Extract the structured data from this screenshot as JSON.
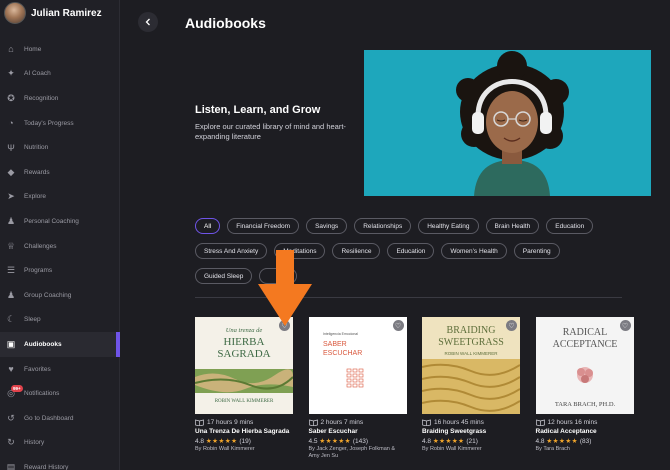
{
  "user": {
    "name": "Julian Ramirez"
  },
  "sidebar": {
    "items": [
      {
        "label": "Home",
        "icon": "house-icon"
      },
      {
        "label": "AI Coach",
        "icon": "sparkle-icon"
      },
      {
        "label": "Recognition",
        "icon": "award-icon"
      },
      {
        "label": "Today's Progress",
        "icon": "progress-icon"
      },
      {
        "label": "Nutrition",
        "icon": "utensils-icon"
      },
      {
        "label": "Rewards",
        "icon": "tag-icon"
      },
      {
        "label": "Explore",
        "icon": "compass-icon"
      },
      {
        "label": "Personal Coaching",
        "icon": "person-icon"
      },
      {
        "label": "Challenges",
        "icon": "trophy-icon"
      },
      {
        "label": "Programs",
        "icon": "layers-icon"
      },
      {
        "label": "Group Coaching",
        "icon": "group-icon"
      },
      {
        "label": "Sleep",
        "icon": "moon-icon"
      },
      {
        "label": "Audiobooks",
        "icon": "book-icon",
        "active": true
      },
      {
        "label": "Favorites",
        "icon": "heart-icon"
      },
      {
        "label": "Notifications",
        "icon": "bell-icon",
        "badge": "99+"
      },
      {
        "label": "Go to Dashboard",
        "icon": "dashboard-icon"
      },
      {
        "label": "History",
        "icon": "history-icon"
      },
      {
        "label": "Reward History",
        "icon": "receipt-icon"
      }
    ]
  },
  "header": {
    "title": "Audiobooks",
    "back_icon": "chevron-left-icon"
  },
  "hero": {
    "heading": "Listen, Learn, and Grow",
    "subtext": "Explore our curated library of mind and heart-expanding literature"
  },
  "filters": {
    "row1": [
      "All",
      "Financial Freedom",
      "Savings",
      "Relationships",
      "Healthy Eating",
      "Brain Health",
      "Education"
    ],
    "row2": [
      "Stress And Anxiety",
      "Meditations",
      "Resilience",
      "Education",
      "Women's Health",
      "Parenting"
    ],
    "row3": [
      "Guided Sleep",
      ""
    ],
    "active": "All"
  },
  "books": [
    {
      "duration": "17 hours 9 mins",
      "title": "Una Trenza De Hierba Sagrada",
      "rating": "4.8",
      "stars": "★★★★★",
      "count": "(19)",
      "author": "By Robin Wall Kimmerer",
      "cover": {
        "line1": "Una trenza de",
        "line2": "HIERBA",
        "line3": "SAGRADA",
        "footer": "ROBIN WALL KIMMERER"
      }
    },
    {
      "duration": "2 hours 7 mins",
      "title": "Saber Escuchar",
      "rating": "4.5",
      "stars": "★★★★★",
      "count": "(143)",
      "author": "By Jack Zenger, Joseph Folkman & Amy Jen Su",
      "cover": {
        "line1": "Inteligencia Emocional",
        "line2": "SABER",
        "line3": "ESCUCHAR",
        "footer": ""
      }
    },
    {
      "duration": "16 hours 45 mins",
      "title": "Braiding Sweetgrass",
      "rating": "4.8",
      "stars": "★★★★★",
      "count": "(21)",
      "author": "By Robin Wall Kimmerer",
      "cover": {
        "line1": "BRAIDING",
        "line2": "SWEETGRASS",
        "line3": "",
        "footer": "ROBIN WALL KIMMERER"
      }
    },
    {
      "duration": "12 hours 16 mins",
      "title": "Radical Acceptance",
      "rating": "4.8",
      "stars": "★★★★★",
      "count": "(83)",
      "author": "By Tara Brach",
      "cover": {
        "line1": "RADICAL",
        "line2": "ACCEPTANCE",
        "line3": "",
        "footer": "TARA BRACH, PH.D."
      }
    }
  ],
  "colors": {
    "accent": "#6f54e8",
    "star": "#f2a62b",
    "arrow": "#f47920",
    "hero_bg": "#1ea7bc"
  }
}
